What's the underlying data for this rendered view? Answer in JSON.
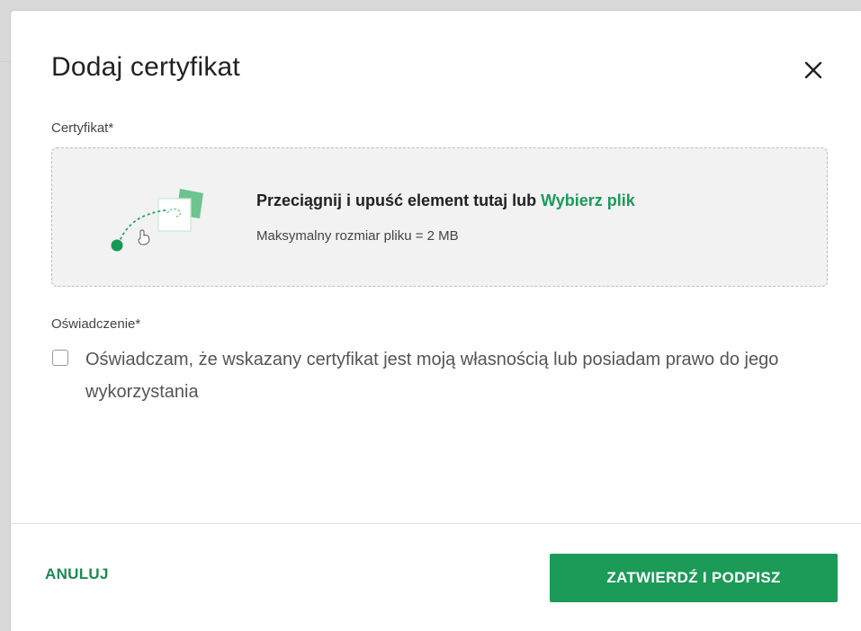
{
  "dialog": {
    "title": "Dodaj certyfikat",
    "close_icon": "close-icon"
  },
  "certificate_field": {
    "label": "Certyfikat*",
    "dropzone": {
      "main_text": "Przeciągnij i upuść element tutaj lub ",
      "link_text": "Wybierz plik",
      "hint": "Maksymalny rozmiar pliku = 2 MB",
      "illustration_icon": "drag-and-drop-illustration"
    }
  },
  "statement_field": {
    "label": "Oświadczenie*",
    "checkbox_checked": false,
    "checkbox_text": "Oświadczam, że wskazany certyfikat jest moją własnością lub posiadam prawo do jego wykorzystania"
  },
  "footer": {
    "cancel_label": "ANULUJ",
    "submit_label": "ZATWIERDŹ I PODPISZ"
  },
  "colors": {
    "accent_green": "#1b9a58",
    "link_green": "#1c9a5a",
    "dropzone_bg": "#f2f2f2"
  }
}
